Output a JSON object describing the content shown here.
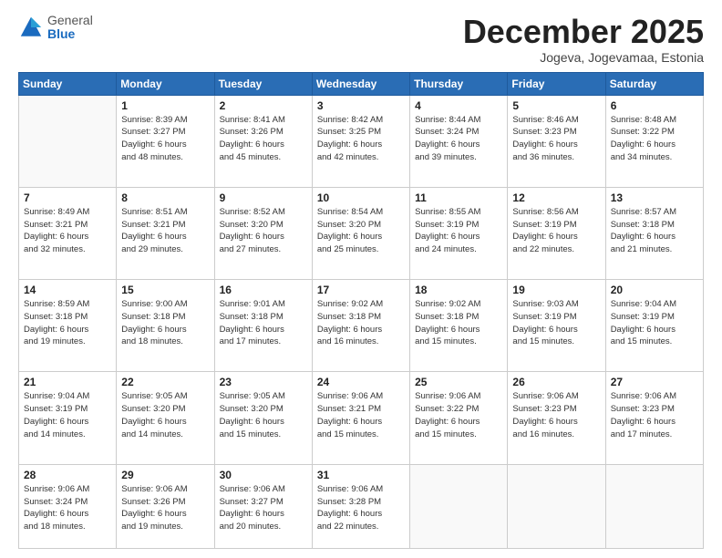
{
  "logo": {
    "general": "General",
    "blue": "Blue"
  },
  "header": {
    "month": "December 2025",
    "location": "Jogeva, Jogevamaa, Estonia"
  },
  "weekdays": [
    "Sunday",
    "Monday",
    "Tuesday",
    "Wednesday",
    "Thursday",
    "Friday",
    "Saturday"
  ],
  "weeks": [
    [
      {
        "day": "",
        "info": ""
      },
      {
        "day": "1",
        "info": "Sunrise: 8:39 AM\nSunset: 3:27 PM\nDaylight: 6 hours\nand 48 minutes."
      },
      {
        "day": "2",
        "info": "Sunrise: 8:41 AM\nSunset: 3:26 PM\nDaylight: 6 hours\nand 45 minutes."
      },
      {
        "day": "3",
        "info": "Sunrise: 8:42 AM\nSunset: 3:25 PM\nDaylight: 6 hours\nand 42 minutes."
      },
      {
        "day": "4",
        "info": "Sunrise: 8:44 AM\nSunset: 3:24 PM\nDaylight: 6 hours\nand 39 minutes."
      },
      {
        "day": "5",
        "info": "Sunrise: 8:46 AM\nSunset: 3:23 PM\nDaylight: 6 hours\nand 36 minutes."
      },
      {
        "day": "6",
        "info": "Sunrise: 8:48 AM\nSunset: 3:22 PM\nDaylight: 6 hours\nand 34 minutes."
      }
    ],
    [
      {
        "day": "7",
        "info": "Sunrise: 8:49 AM\nSunset: 3:21 PM\nDaylight: 6 hours\nand 32 minutes."
      },
      {
        "day": "8",
        "info": "Sunrise: 8:51 AM\nSunset: 3:21 PM\nDaylight: 6 hours\nand 29 minutes."
      },
      {
        "day": "9",
        "info": "Sunrise: 8:52 AM\nSunset: 3:20 PM\nDaylight: 6 hours\nand 27 minutes."
      },
      {
        "day": "10",
        "info": "Sunrise: 8:54 AM\nSunset: 3:20 PM\nDaylight: 6 hours\nand 25 minutes."
      },
      {
        "day": "11",
        "info": "Sunrise: 8:55 AM\nSunset: 3:19 PM\nDaylight: 6 hours\nand 24 minutes."
      },
      {
        "day": "12",
        "info": "Sunrise: 8:56 AM\nSunset: 3:19 PM\nDaylight: 6 hours\nand 22 minutes."
      },
      {
        "day": "13",
        "info": "Sunrise: 8:57 AM\nSunset: 3:18 PM\nDaylight: 6 hours\nand 21 minutes."
      }
    ],
    [
      {
        "day": "14",
        "info": "Sunrise: 8:59 AM\nSunset: 3:18 PM\nDaylight: 6 hours\nand 19 minutes."
      },
      {
        "day": "15",
        "info": "Sunrise: 9:00 AM\nSunset: 3:18 PM\nDaylight: 6 hours\nand 18 minutes."
      },
      {
        "day": "16",
        "info": "Sunrise: 9:01 AM\nSunset: 3:18 PM\nDaylight: 6 hours\nand 17 minutes."
      },
      {
        "day": "17",
        "info": "Sunrise: 9:02 AM\nSunset: 3:18 PM\nDaylight: 6 hours\nand 16 minutes."
      },
      {
        "day": "18",
        "info": "Sunrise: 9:02 AM\nSunset: 3:18 PM\nDaylight: 6 hours\nand 15 minutes."
      },
      {
        "day": "19",
        "info": "Sunrise: 9:03 AM\nSunset: 3:19 PM\nDaylight: 6 hours\nand 15 minutes."
      },
      {
        "day": "20",
        "info": "Sunrise: 9:04 AM\nSunset: 3:19 PM\nDaylight: 6 hours\nand 15 minutes."
      }
    ],
    [
      {
        "day": "21",
        "info": "Sunrise: 9:04 AM\nSunset: 3:19 PM\nDaylight: 6 hours\nand 14 minutes."
      },
      {
        "day": "22",
        "info": "Sunrise: 9:05 AM\nSunset: 3:20 PM\nDaylight: 6 hours\nand 14 minutes."
      },
      {
        "day": "23",
        "info": "Sunrise: 9:05 AM\nSunset: 3:20 PM\nDaylight: 6 hours\nand 15 minutes."
      },
      {
        "day": "24",
        "info": "Sunrise: 9:06 AM\nSunset: 3:21 PM\nDaylight: 6 hours\nand 15 minutes."
      },
      {
        "day": "25",
        "info": "Sunrise: 9:06 AM\nSunset: 3:22 PM\nDaylight: 6 hours\nand 15 minutes."
      },
      {
        "day": "26",
        "info": "Sunrise: 9:06 AM\nSunset: 3:23 PM\nDaylight: 6 hours\nand 16 minutes."
      },
      {
        "day": "27",
        "info": "Sunrise: 9:06 AM\nSunset: 3:23 PM\nDaylight: 6 hours\nand 17 minutes."
      }
    ],
    [
      {
        "day": "28",
        "info": "Sunrise: 9:06 AM\nSunset: 3:24 PM\nDaylight: 6 hours\nand 18 minutes."
      },
      {
        "day": "29",
        "info": "Sunrise: 9:06 AM\nSunset: 3:26 PM\nDaylight: 6 hours\nand 19 minutes."
      },
      {
        "day": "30",
        "info": "Sunrise: 9:06 AM\nSunset: 3:27 PM\nDaylight: 6 hours\nand 20 minutes."
      },
      {
        "day": "31",
        "info": "Sunrise: 9:06 AM\nSunset: 3:28 PM\nDaylight: 6 hours\nand 22 minutes."
      },
      {
        "day": "",
        "info": ""
      },
      {
        "day": "",
        "info": ""
      },
      {
        "day": "",
        "info": ""
      }
    ]
  ]
}
